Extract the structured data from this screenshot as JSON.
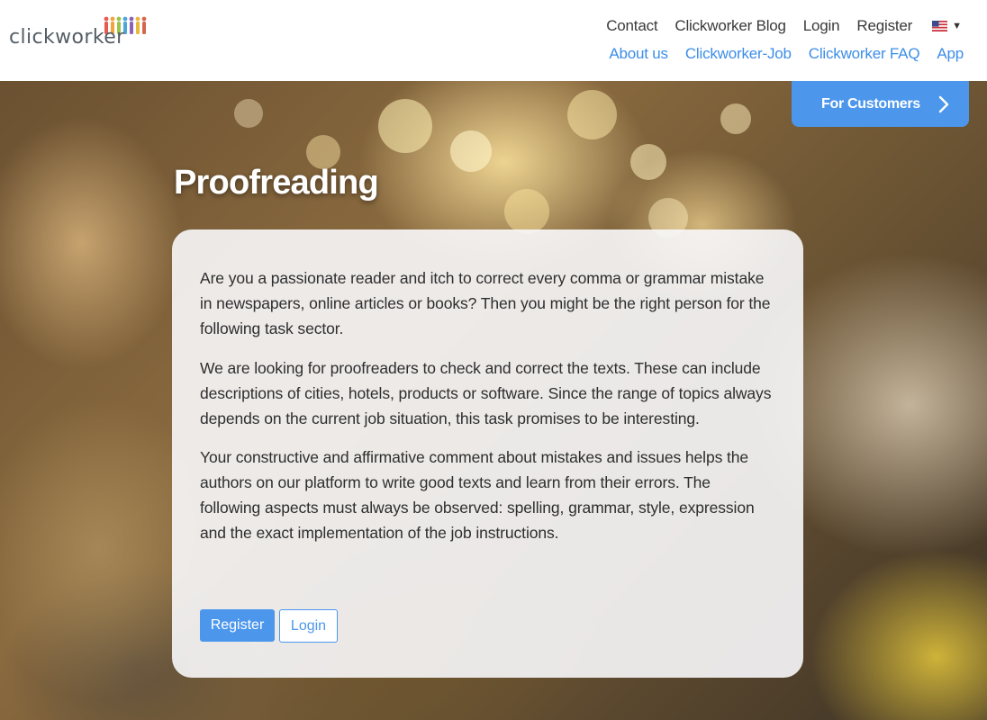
{
  "logo": {
    "text": "clickworker"
  },
  "nav": {
    "top": [
      "Contact",
      "Clickworker Blog",
      "Login",
      "Register"
    ],
    "bottom": [
      "About us",
      "Clickworker-Job",
      "Clickworker FAQ",
      "App"
    ],
    "language_icon": "us-flag-icon"
  },
  "customers_button": {
    "label": "For Customers"
  },
  "hero": {
    "title": "Proofreading",
    "paragraphs": [
      "Are you a passionate reader and itch to correct every comma or grammar mistake in newspapers, online articles or books? Then you might be the right person for the following task sector.",
      "We are looking for proofreaders to check and correct the texts. These can include descriptions of cities, hotels, products or software. Since the range of topics always depends on the current job situation, this task promises to be interesting.",
      "Your constructive and affirmative comment about mistakes and issues helps the authors on our platform to write good texts and learn from their errors. The following aspects must always be observed: spelling, grammar, style, expression and the exact implementation of the job instructions."
    ],
    "register_label": "Register",
    "login_label": "Login"
  },
  "colors": {
    "accent": "#4c97ec",
    "nav_link": "#3d8ee8",
    "text": "#2e2e2e"
  }
}
